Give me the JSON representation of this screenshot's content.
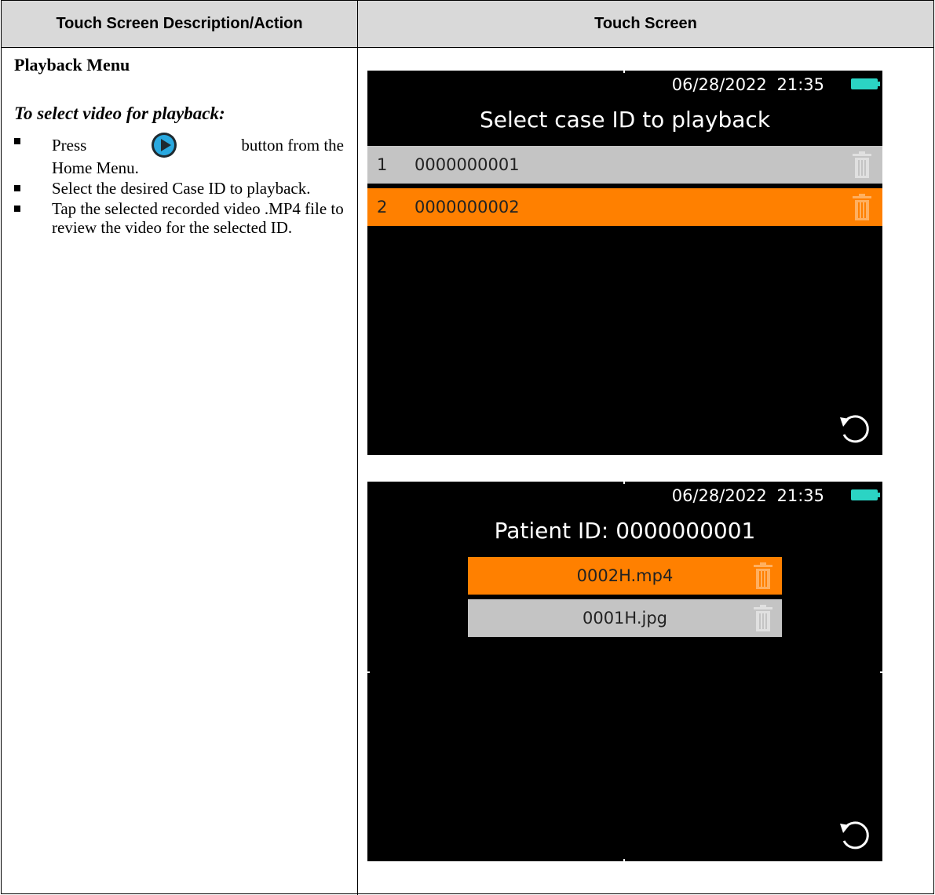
{
  "table": {
    "header_left": "Touch Screen Description/Action",
    "header_right": "Touch Screen"
  },
  "left": {
    "section_title": "Playback Menu",
    "subheading": "To select video for playback:",
    "bullet1_press": "Press",
    "bullet1_after": "button from the",
    "bullet1_line2": "Home Menu.",
    "bullet2": "Select the desired Case ID to playback.",
    "bullet3": "Tap the selected recorded video .MP4 file to review the video for the selected ID."
  },
  "screen1": {
    "date": "06/28/2022",
    "time": "21:35",
    "title": "Select case ID to playback",
    "rows": [
      {
        "num": "1",
        "case_id": "0000000001"
      },
      {
        "num": "2",
        "case_id": "0000000002"
      }
    ]
  },
  "screen2": {
    "date": "06/28/2022",
    "time": "21:35",
    "title": "Patient ID: 0000000001",
    "files": [
      {
        "name": "0002H.mp4"
      },
      {
        "name": "0001H.jpg"
      }
    ]
  },
  "colors": {
    "selected_row": "#ff8000",
    "unselected_row": "#c4c4c4",
    "battery": "#2bd4c4",
    "header_bg": "#d9d9d9",
    "play_icon": "#29a9e0"
  },
  "icons": {
    "play": "play-circle-icon",
    "trash": "trash-icon",
    "back": "undo-arrow-icon",
    "battery": "battery-icon"
  }
}
